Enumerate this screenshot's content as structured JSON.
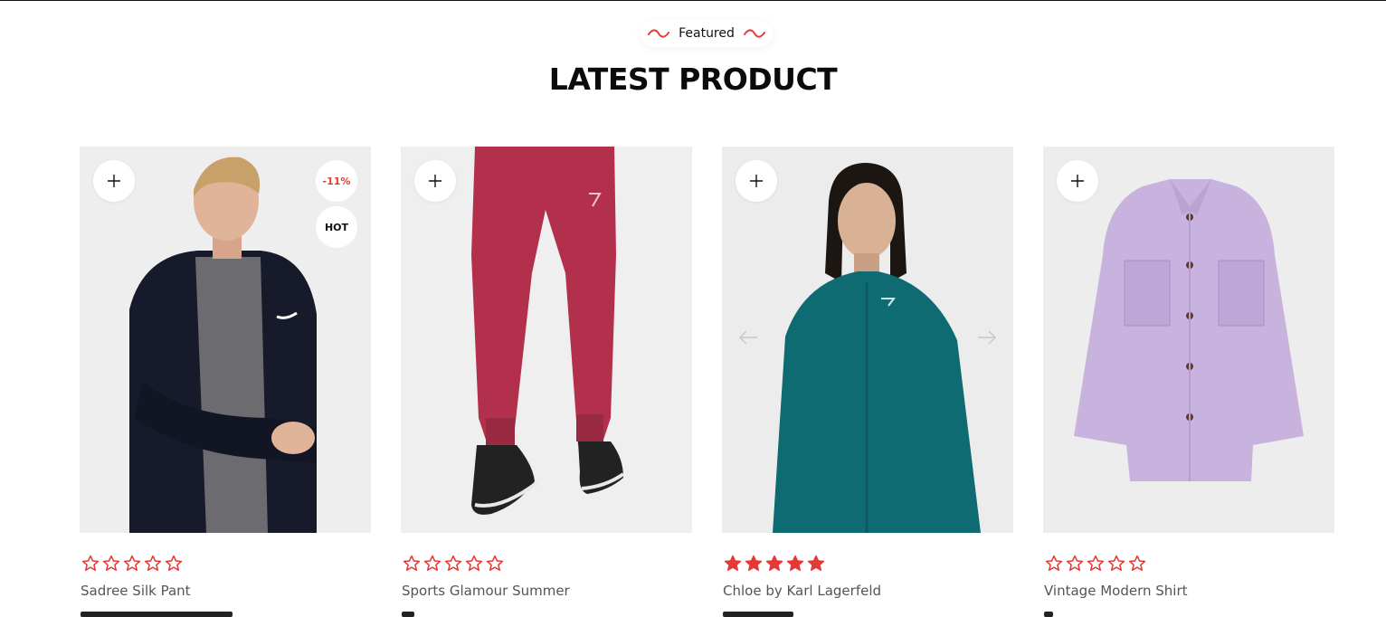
{
  "section": {
    "eyebrow": "Featured",
    "title": "LATEST PRODUCT"
  },
  "colors": {
    "accent": "#e53935",
    "card_bg": "#ececec",
    "text": "#111111",
    "muted": "#555555"
  },
  "products": [
    {
      "name": "Sadree Silk Pant",
      "rating": 0,
      "badges": {
        "discount": "-11%",
        "hot": "HOT"
      }
    },
    {
      "name": "Sports Glamour Summer",
      "rating": 0
    },
    {
      "name": "Chloe by Karl Lagerfeld",
      "rating": 5
    },
    {
      "name": "Vintage Modern Shirt",
      "rating": 0
    }
  ],
  "icons": {
    "add": "plus-icon",
    "star_empty": "star-outline-icon",
    "star_full": "star-filled-icon",
    "prev": "arrow-left-icon",
    "next": "arrow-right-icon"
  }
}
